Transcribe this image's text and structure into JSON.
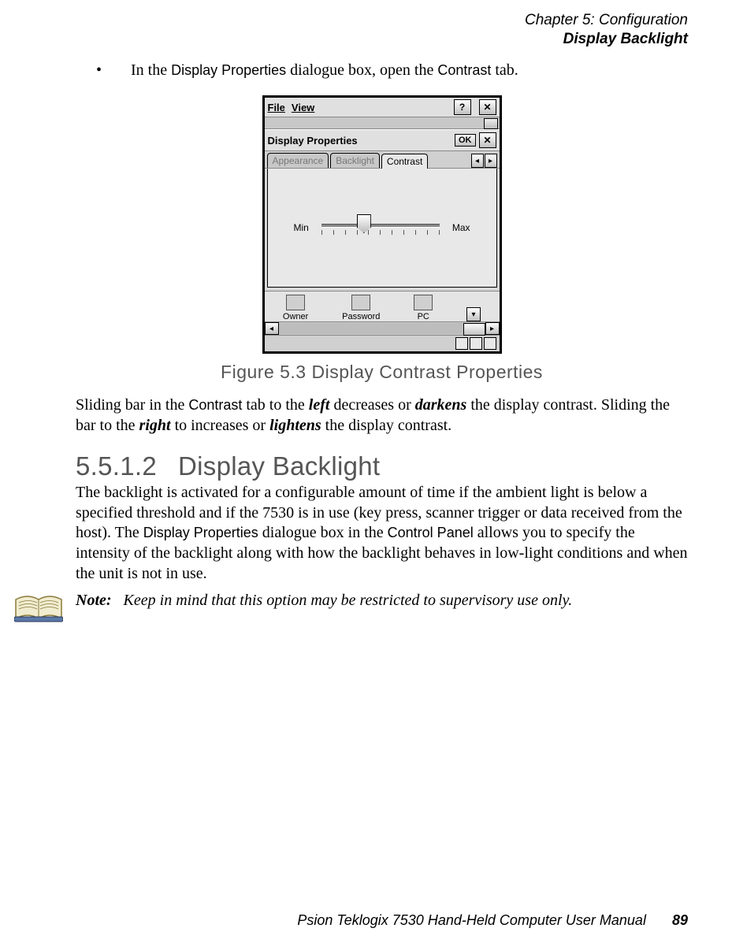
{
  "header": {
    "line1": "Chapter 5: Configuration",
    "line2": "Display Backlight"
  },
  "bullet": {
    "pre": "In the ",
    "ui1": "Display Properties",
    "mid": " dialogue box, open the ",
    "ui2": "Contrast",
    "post": " tab."
  },
  "shot": {
    "menu_file": "File",
    "menu_view": "View",
    "help": "?",
    "close": "✕",
    "title": "Display Properties",
    "ok": "OK",
    "tabs": {
      "appearance": "Appearance",
      "backlight": "Backlight",
      "contrast": "Contrast"
    },
    "arr_left": "◂",
    "arr_right": "▸",
    "min": "Min",
    "max": "Max",
    "icons": {
      "owner": "Owner",
      "password": "Password",
      "pc": "PC"
    },
    "down": "▾",
    "scroll_left": "◂",
    "scroll_right": "▸"
  },
  "figcap": "Figure 5.3 Display Contrast Properties",
  "para1": {
    "a": "Sliding bar in the ",
    "ui": "Contrast",
    "b": " tab to the ",
    "left": "left",
    "c": " decreases or ",
    "darkens": "darkens",
    "d": " the display contrast. Sliding the bar to the ",
    "right": "right",
    "e": " to increases or ",
    "lightens": "lightens",
    "f": " the display contrast."
  },
  "section": {
    "num": "5.5.1.2",
    "title": "Display Backlight"
  },
  "para2": {
    "a": "The backlight is activated for a configurable amount of time if the ambient light is below a specified threshold and if the 7530 is in use (key press, scanner trigger or data received from the host). The ",
    "ui1": "Display Properties",
    "b": " dialogue box in the ",
    "ui2": "Control Panel",
    "c": " allows you to specify the intensity of the backlight along with how the backlight behaves in low-light conditions and when the unit is not in use."
  },
  "note": {
    "label": "Note:",
    "text": "Keep in mind that this option may be restricted to supervisory use only."
  },
  "footer": {
    "book": "Psion Teklogix 7530 Hand-Held Computer User Manual",
    "page": "89"
  }
}
